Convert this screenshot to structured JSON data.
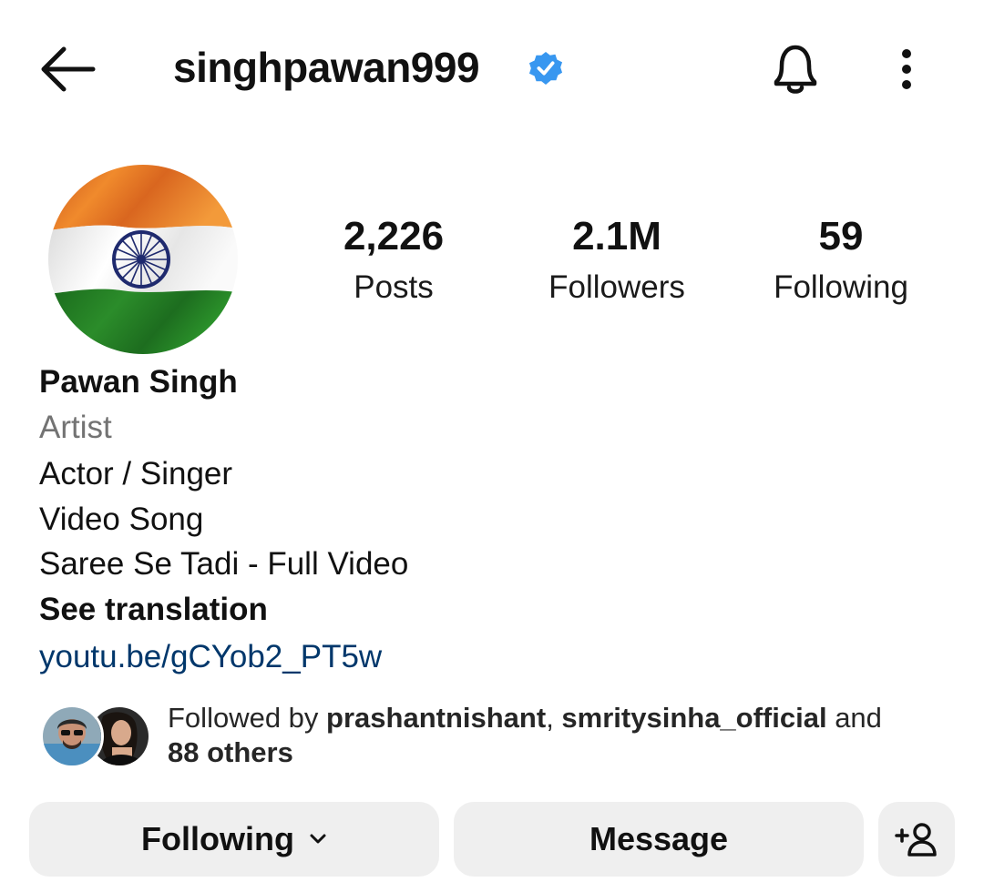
{
  "header": {
    "username": "singhpawan999",
    "verified": true,
    "icons": [
      "back-arrow-icon",
      "verified-badge-icon",
      "bell-icon",
      "more-options-icon"
    ]
  },
  "profile": {
    "avatar": "indian-flag-avatar",
    "stats": [
      {
        "value": "2,226",
        "label": "Posts"
      },
      {
        "value": "2.1M",
        "label": "Followers"
      },
      {
        "value": "59",
        "label": "Following"
      }
    ]
  },
  "bio": {
    "name": "Pawan Singh",
    "category": "Artist",
    "lines": [
      "Actor / Singer",
      "Video Song",
      "Saree Se Tadi - Full Video"
    ],
    "see_translation": "See translation",
    "link": "youtu.be/gCYob2_PT5w"
  },
  "followed_by": {
    "prefix": "Followed by ",
    "user1": "prashantnishant",
    "separator": ", ",
    "user2": "smritysinha_official",
    "and_text": " and",
    "others": "88 others"
  },
  "actions": {
    "following_label": "Following",
    "message_label": "Message"
  },
  "colors": {
    "verified_blue": "#3897f0",
    "link_blue": "#00376b",
    "button_bg": "#efefef",
    "secondary_text": "#737373"
  }
}
